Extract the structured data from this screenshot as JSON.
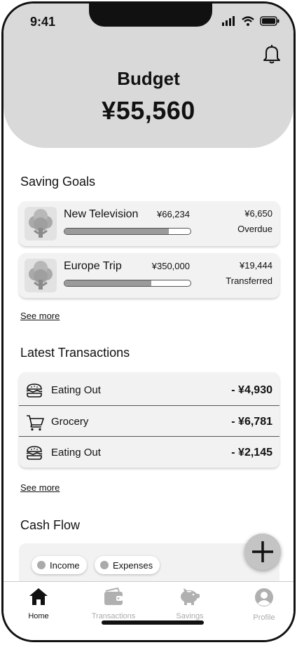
{
  "status": {
    "time": "9:41"
  },
  "header": {
    "title": "Budget",
    "amount": "¥55,560"
  },
  "saving_goals": {
    "title": "Saving Goals",
    "items": [
      {
        "name": "New Television",
        "target": "¥66,234",
        "saved": "¥6,650",
        "status": "Overdue",
        "progress": 0.83
      },
      {
        "name": "Europe Trip",
        "target": "¥350,000",
        "saved": "¥19,444",
        "status": "Transferred",
        "progress": 0.69
      }
    ],
    "see_more": "See more"
  },
  "transactions": {
    "title": "Latest Transactions",
    "items": [
      {
        "label": "Eating Out",
        "amount": "- ¥4,930",
        "icon": "burger-icon"
      },
      {
        "label": "Grocery",
        "amount": "- ¥6,781",
        "icon": "cart-icon"
      },
      {
        "label": "Eating Out",
        "amount": "- ¥2,145",
        "icon": "burger-icon"
      }
    ],
    "see_more": "See more"
  },
  "cash_flow": {
    "title": "Cash Flow",
    "legend": [
      {
        "label": "Income"
      },
      {
        "label": "Expenses"
      }
    ]
  },
  "tabs": [
    {
      "label": "Home",
      "icon": "home-icon",
      "active": true
    },
    {
      "label": "Transactions",
      "icon": "wallet-icon",
      "active": false
    },
    {
      "label": "Savings",
      "icon": "piggy-bank-icon",
      "active": false
    },
    {
      "label": "Profile",
      "icon": "user-icon",
      "active": false
    }
  ],
  "colors": {
    "header_bg": "#d9d9d9",
    "card_bg": "#f2f2f2",
    "progress_fill": "#9a9a9a",
    "fab_bg": "#c4c4c4"
  }
}
